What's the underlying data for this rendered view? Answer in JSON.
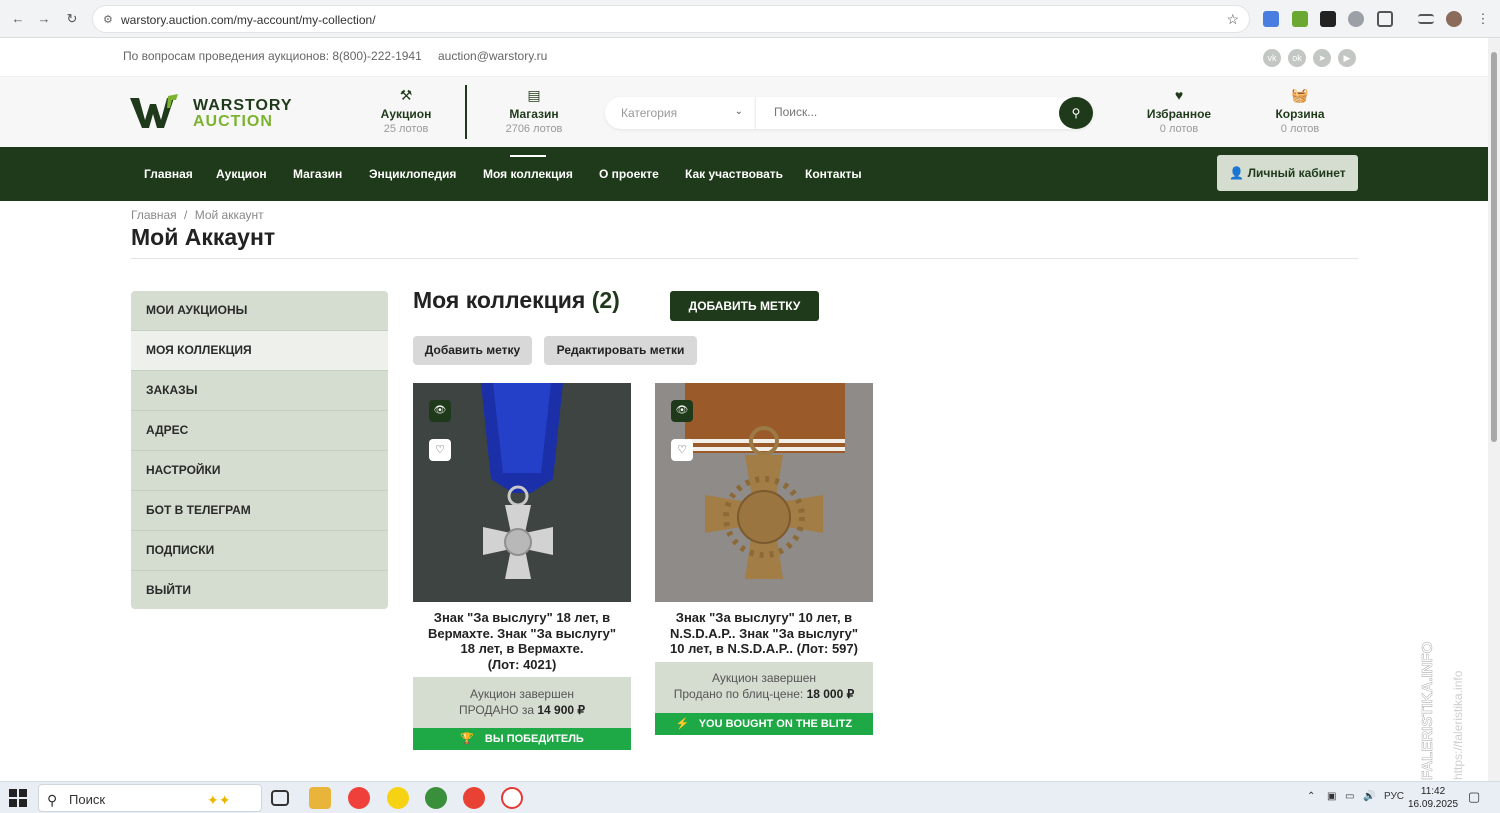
{
  "browser": {
    "url": "warstory.auction.com/my-account/my-collection/"
  },
  "topline": {
    "info": "По вопросам проведения аукционов: 8(800)-222-1941",
    "email": "auction@warstory.ru"
  },
  "logo": {
    "line1": "WARSTORY",
    "line2": "AUCTION"
  },
  "header": {
    "auction": {
      "title": "Аукцион",
      "sub": "25 лотов"
    },
    "shop": {
      "title": "Магазин",
      "sub": "2706 лотов"
    },
    "category_placeholder": "Категория",
    "search_placeholder": "Поиск...",
    "favorites": {
      "title": "Избранное",
      "sub": "0 лотов"
    },
    "cart": {
      "title": "Корзина",
      "sub": "0 лотов"
    }
  },
  "nav": {
    "items": [
      "Главная",
      "Аукцион",
      "Магазин",
      "Энциклопедия",
      "Моя коллекция",
      "О проекте",
      "Как участвовать",
      "Контакты"
    ],
    "account": "Личный кабинет"
  },
  "breadcrumb": {
    "home": "Главная",
    "sep": "/",
    "current": "Мой аккаунт"
  },
  "page_title": "Мой Аккаунт",
  "sidebar": {
    "items": [
      "МОИ АУКЦИОНЫ",
      "МОЯ КОЛЛЕКЦИЯ",
      "ЗАКАЗЫ",
      "АДРЕС",
      "НАСТРОЙКИ",
      "БОТ В ТЕЛЕГРАМ",
      "ПОДПИСКИ",
      "ВЫЙТИ"
    ]
  },
  "collection": {
    "title": "Моя коллекция",
    "count": "(2)",
    "add_tag_primary": "ДОБАВИТЬ МЕТКУ",
    "add_tag": "Добавить метку",
    "edit_tags": "Редактировать метки"
  },
  "cards": [
    {
      "title": "Знак \"За выслугу\" 18 лет, в Вермахте. Знак \"За выслугу\" 18 лет, в Вермахте.",
      "lot": "(Лот: 4021)",
      "status": "Аукцион завершен",
      "price_label": "ПРОДАНО за",
      "price": "14 900 ₽",
      "badge": "ВЫ ПОБЕДИТЕЛЬ"
    },
    {
      "title": "Знак \"За выслугу\" 10 лет, в N.S.D.A.P.. Знак \"За выслугу\" 10 лет, в N.S.D.A.P.. (Лот: 597)",
      "status": "Аукцион завершен",
      "price_label": "Продано по блиц-цене:",
      "price": "18 000 ₽",
      "badge": "YOU BOUGHT ON THE BLITZ"
    }
  ],
  "watermark": {
    "line1": "FALERISTIKA.INFO",
    "line2": "https://faleristika.info"
  },
  "taskbar": {
    "search": "Поиск",
    "lang": "РУС",
    "time": "11:42",
    "date": "16.09.2025"
  },
  "colors": {
    "brand": "#1f3a1a",
    "accent": "#7bb32e",
    "success": "#1fa846",
    "panel": "#d5ddd0"
  }
}
